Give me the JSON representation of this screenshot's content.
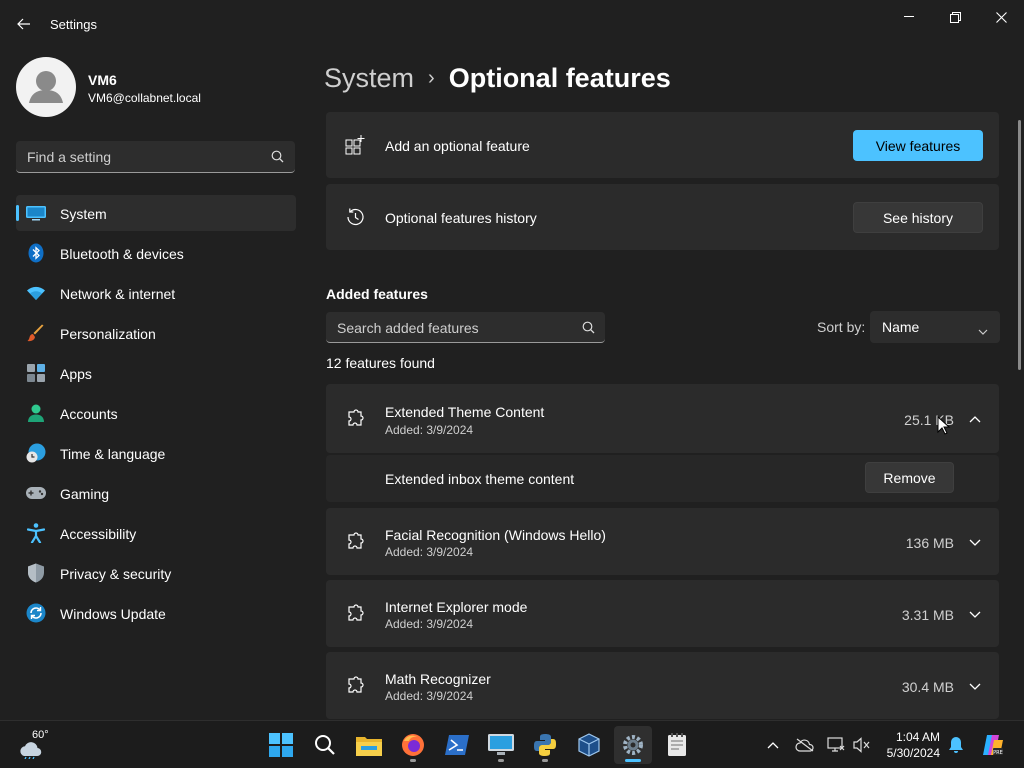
{
  "window": {
    "title": "Settings"
  },
  "user": {
    "name": "VM6",
    "email": "VM6@collabnet.local"
  },
  "search": {
    "placeholder": "Find a setting"
  },
  "nav": [
    {
      "label": "System",
      "icon": "system-icon",
      "active": true
    },
    {
      "label": "Bluetooth & devices",
      "icon": "bluetooth-icon"
    },
    {
      "label": "Network & internet",
      "icon": "wifi-icon"
    },
    {
      "label": "Personalization",
      "icon": "brush-icon"
    },
    {
      "label": "Apps",
      "icon": "apps-icon"
    },
    {
      "label": "Accounts",
      "icon": "person-icon"
    },
    {
      "label": "Time & language",
      "icon": "globe-clock-icon"
    },
    {
      "label": "Gaming",
      "icon": "gamepad-icon"
    },
    {
      "label": "Accessibility",
      "icon": "accessibility-icon"
    },
    {
      "label": "Privacy & security",
      "icon": "shield-icon"
    },
    {
      "label": "Windows Update",
      "icon": "update-icon"
    }
  ],
  "breadcrumb": {
    "parent": "System",
    "separator": "›",
    "current": "Optional features"
  },
  "add_feature": {
    "label": "Add an optional feature",
    "button": "View features"
  },
  "history": {
    "label": "Optional features history",
    "button": "See history"
  },
  "added": {
    "title": "Added features",
    "search_placeholder": "Search added features",
    "sort_label": "Sort by:",
    "sort_value": "Name",
    "count": "12 features found"
  },
  "features": [
    {
      "name": "Extended Theme Content",
      "date": "Added: 3/9/2024",
      "size": "25.1 KB",
      "expanded": true,
      "detail": "Extended inbox theme content",
      "action": "Remove"
    },
    {
      "name": "Facial Recognition (Windows Hello)",
      "date": "Added: 3/9/2024",
      "size": "136 MB"
    },
    {
      "name": "Internet Explorer mode",
      "date": "Added: 3/9/2024",
      "size": "3.31 MB"
    },
    {
      "name": "Math Recognizer",
      "date": "Added: 3/9/2024",
      "size": "30.4 MB"
    }
  ],
  "taskbar": {
    "weather_temp": "60°",
    "time": "1:04 AM",
    "date": "5/30/2024",
    "apps": [
      "start-icon",
      "search-icon",
      "file-explorer-icon",
      "firefox-icon",
      "powershell-icon",
      "remote-desktop-icon",
      "python-icon",
      "virtualbox-icon",
      "settings-icon",
      "notepad-icon"
    ]
  },
  "colors": {
    "accent": "#4cc2ff",
    "background": "#202020",
    "card": "#2b2b2b"
  }
}
